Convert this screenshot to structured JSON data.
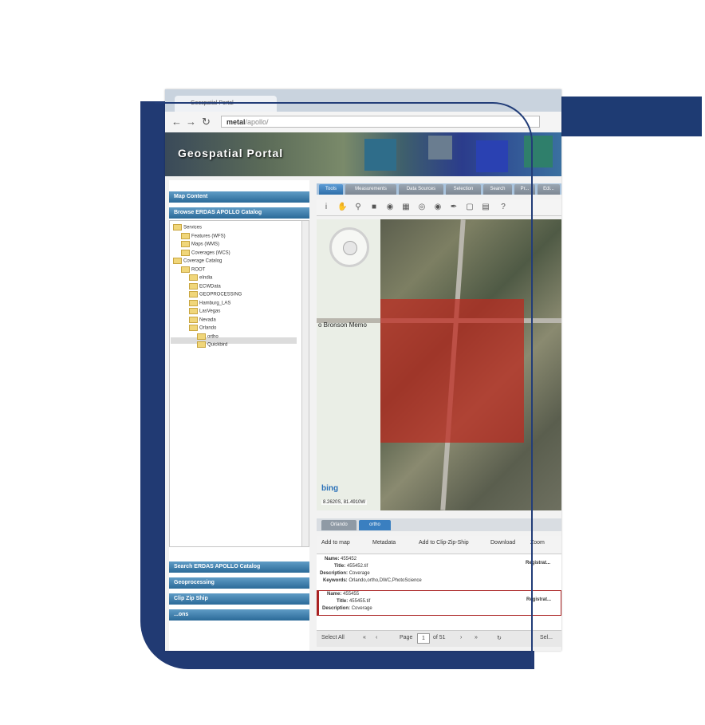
{
  "browser": {
    "tab_title": "Geospatial Portal",
    "url_host": "metal",
    "url_path": "/apollo/"
  },
  "banner": {
    "title": "Geospatial Portal"
  },
  "left_panel": {
    "map_content": "Map Content",
    "browse_catalog": "Browse ERDAS APOLLO Catalog",
    "tree": [
      {
        "label": "Services",
        "icon": "minus"
      },
      {
        "label": "Features (WFS)",
        "icon": "plus"
      },
      {
        "label": "Maps (WMS)",
        "icon": "plus"
      },
      {
        "label": "Coverages (WCS)",
        "icon": "plus"
      },
      {
        "label": "Coverage Catalog",
        "icon": "minus"
      },
      {
        "label": "ROOT",
        "icon": "minus"
      },
      {
        "label": "eIndia",
        "icon": ""
      },
      {
        "label": "ECWData",
        "icon": ""
      },
      {
        "label": "GEOPROCESSING",
        "icon": ""
      },
      {
        "label": "Hamburg_LAS",
        "icon": ""
      },
      {
        "label": "LasVegas",
        "icon": ""
      },
      {
        "label": "Nevada",
        "icon": ""
      },
      {
        "label": "Orlando",
        "icon": "minus"
      },
      {
        "label": "ortho",
        "icon": ""
      },
      {
        "label": "Quickbird",
        "icon": ""
      }
    ],
    "search_catalog": "Search ERDAS APOLLO Catalog",
    "geoprocessing": "Geoprocessing",
    "clip_zip_ship": "Clip Zip Ship",
    "last_header": "...ons"
  },
  "tabs": [
    "Tools",
    "Measurements",
    "Data Sources",
    "Selection",
    "Search",
    "Pr...",
    "Edi..."
  ],
  "map": {
    "label_left": "o Bronson Memo",
    "bing": "bing",
    "coords": "8.2620S, 81.4910W"
  },
  "results": {
    "tabs": [
      "Orlando",
      "ortho"
    ],
    "actions": [
      "Add to map",
      "Metadata",
      "Add to Clip-Zip-Ship",
      "Download",
      "Zoom"
    ],
    "items": [
      {
        "name": "455452",
        "title": "455452.tif",
        "description": "Coverage",
        "keywords": "Orlando,ortho,DWC,PhotoScience",
        "registered": "Registrat..."
      },
      {
        "name": "455455",
        "title": "455455.tif",
        "description": "Coverage",
        "registered": "Registrat..."
      }
    ]
  },
  "pager": {
    "select_all": "Select All",
    "page_label": "Page",
    "page_value": "1",
    "of_label": "of 51",
    "right_label": "Sel..."
  }
}
